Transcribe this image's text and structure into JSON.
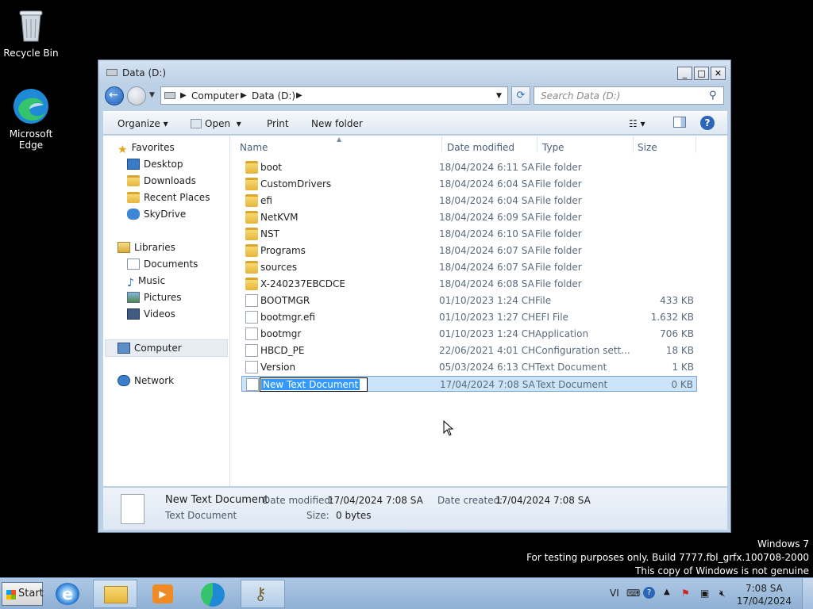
{
  "desktop": {
    "recycle_bin_label": "Recycle Bin",
    "edge_label_line1": "Microsoft",
    "edge_label_line2": "Edge"
  },
  "window": {
    "title": "Data (D:)",
    "controls": {
      "minimize": "_",
      "maximize": "□",
      "close": "✕"
    }
  },
  "address_bar": {
    "crumbs": [
      "Computer",
      "Data (D:)"
    ],
    "search_placeholder": "Search Data (D:)"
  },
  "toolbar": {
    "organize": "Organize",
    "open": "Open",
    "print": "Print",
    "new_folder": "New folder"
  },
  "nav_pane": {
    "favorites": "Favorites",
    "favorites_items": [
      "Desktop",
      "Downloads",
      "Recent Places",
      "SkyDrive"
    ],
    "libraries": "Libraries",
    "libraries_items": [
      "Documents",
      "Music",
      "Pictures",
      "Videos"
    ],
    "computer": "Computer",
    "network": "Network"
  },
  "columns": {
    "name": "Name",
    "date_modified": "Date modified",
    "type": "Type",
    "size": "Size"
  },
  "files": [
    {
      "name": "boot",
      "date": "18/04/2024 6:11 SA",
      "type": "File folder",
      "size": "",
      "kind": "folder"
    },
    {
      "name": "CustomDrivers",
      "date": "18/04/2024 6:04 SA",
      "type": "File folder",
      "size": "",
      "kind": "folder"
    },
    {
      "name": "efi",
      "date": "18/04/2024 6:04 SA",
      "type": "File folder",
      "size": "",
      "kind": "folder"
    },
    {
      "name": "NetKVM",
      "date": "18/04/2024 6:09 SA",
      "type": "File folder",
      "size": "",
      "kind": "folder"
    },
    {
      "name": "NST",
      "date": "18/04/2024 6:10 SA",
      "type": "File folder",
      "size": "",
      "kind": "folder"
    },
    {
      "name": "Programs",
      "date": "18/04/2024 6:07 SA",
      "type": "File folder",
      "size": "",
      "kind": "folder"
    },
    {
      "name": "sources",
      "date": "18/04/2024 6:07 SA",
      "type": "File folder",
      "size": "",
      "kind": "folder"
    },
    {
      "name": "X-240237EBCDCE",
      "date": "18/04/2024 6:08 SA",
      "type": "File folder",
      "size": "",
      "kind": "folder"
    },
    {
      "name": "BOOTMGR",
      "date": "01/10/2023 1:24 CH",
      "type": "File",
      "size": "433 KB",
      "kind": "file"
    },
    {
      "name": "bootmgr.efi",
      "date": "01/10/2023 1:27 CH",
      "type": "EFI File",
      "size": "1.632 KB",
      "kind": "file"
    },
    {
      "name": "bootmgr",
      "date": "01/10/2023 1:24 CH",
      "type": "Application",
      "size": "706 KB",
      "kind": "file"
    },
    {
      "name": "HBCD_PE",
      "date": "22/06/2021 4:01 CH",
      "type": "Configuration sett...",
      "size": "18 KB",
      "kind": "file"
    },
    {
      "name": "Version",
      "date": "05/03/2024 6:13 CH",
      "type": "Text Document",
      "size": "1 KB",
      "kind": "file"
    },
    {
      "name": "New Text Document",
      "date": "17/04/2024 7:08 SA",
      "type": "Text Document",
      "size": "0 KB",
      "kind": "file",
      "selected": true
    }
  ],
  "details": {
    "name": "New Text Document",
    "kind": "Text Document",
    "date_modified_label": "Date modified:",
    "date_modified": "17/04/2024 7:08 SA",
    "date_created_label": "Date created:",
    "date_created": "17/04/2024 7:08 SA",
    "size_label": "Size:",
    "size": "0 bytes"
  },
  "watermark": {
    "line1": "Windows 7",
    "line2": "For testing purposes only. Build 7777.fbl_grfx.100708-2000",
    "line3": "This copy of Windows is not genuine"
  },
  "taskbar": {
    "start_label": "Start",
    "language": "VI",
    "time": "7:08 SA",
    "date": "17/04/2024"
  },
  "colors": {
    "accent": "#3399ff",
    "selection": "#cce4f7",
    "taskbar": "#9bbbdd"
  }
}
